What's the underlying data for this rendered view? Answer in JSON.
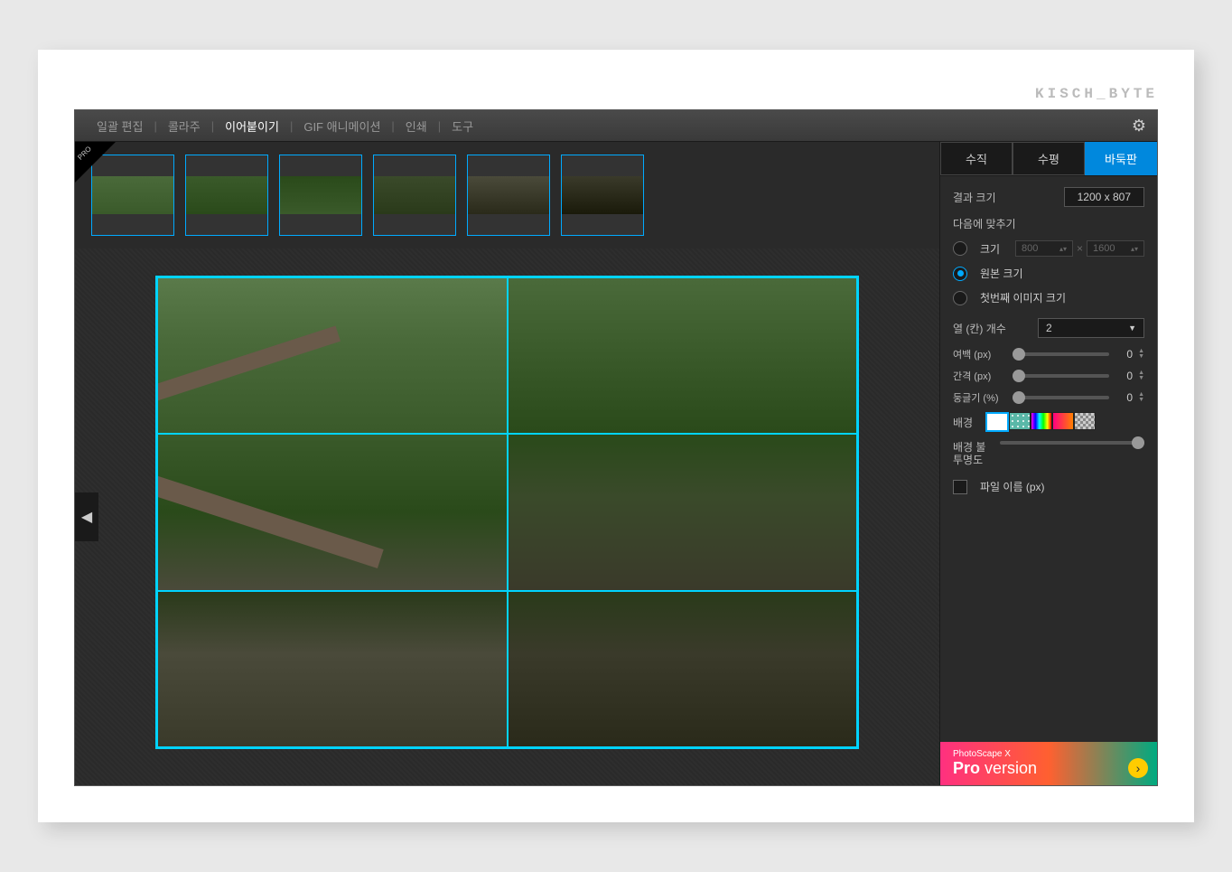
{
  "watermark": "KISCH_BYTE",
  "tabs": [
    "일괄 편집",
    "콜라주",
    "이어붙이기",
    "GIF 애니메이션",
    "인쇄",
    "도구"
  ],
  "active_tab": 2,
  "pro_label": "PRO",
  "orient_tabs": [
    "수직",
    "수평",
    "바둑판"
  ],
  "active_orient": 2,
  "result_size_label": "결과 크기",
  "result_size_value": "1200 x 807",
  "fit_label": "다음에 맞추기",
  "radio_size_label": "크기",
  "radio_orig_label": "원본 크기",
  "radio_first_label": "첫번째 이미지 크기",
  "size_w": "800",
  "size_h": "1600",
  "cols_label": "열 (칸) 개수",
  "cols_value": "2",
  "margin_label": "여백 (px)",
  "gap_label": "간격 (px)",
  "round_label": "둥글기 (%)",
  "margin_val": "0",
  "gap_val": "0",
  "round_val": "0",
  "bg_label": "배경",
  "opacity_label": "배경 불투명도",
  "filename_label": "파일 이름 (px)",
  "ad_small": "PhotoScape X",
  "ad_big_1": "Pro ",
  "ad_big_2": "version"
}
